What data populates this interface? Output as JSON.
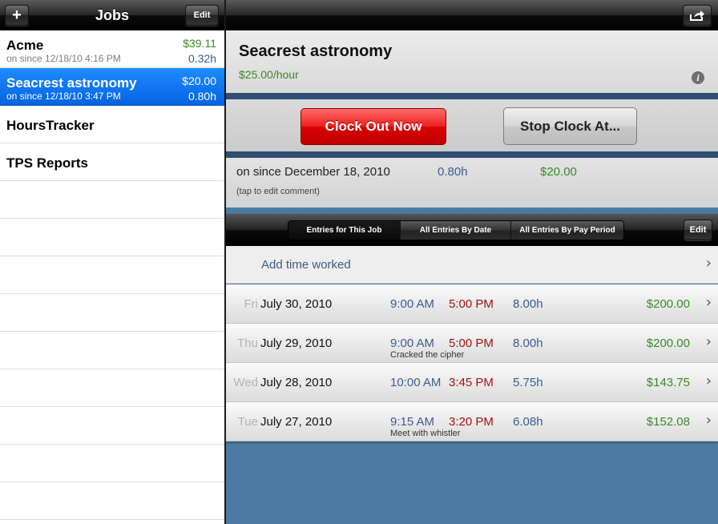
{
  "jobs_panel": {
    "title": "Jobs",
    "add_label": "+",
    "edit_label": "Edit",
    "jobs": [
      {
        "name": "Acme",
        "status": "on since 12/18/10 4:16 PM",
        "amount": "$39.11",
        "hours": "0.32h"
      },
      {
        "name": "Seacrest astronomy",
        "status": "on since 12/18/10 3:47 PM",
        "amount": "$20.00",
        "hours": "0.80h"
      },
      {
        "name": "HoursTracker",
        "status": "",
        "amount": "",
        "hours": ""
      },
      {
        "name": "TPS Reports",
        "status": "",
        "amount": "",
        "hours": ""
      }
    ]
  },
  "detail": {
    "share_icon": "share-icon",
    "job_title": "Seacrest astronomy",
    "rate": "$25.00/hour",
    "info_icon": "i",
    "clock_out_label": "Clock Out Now",
    "stop_clock_label": "Stop Clock At...",
    "session": {
      "text": "on since December 18, 2010",
      "hours": "0.80h",
      "amount": "$20.00",
      "comment": "(tap to edit comment)"
    },
    "segments": [
      "Entries for This Job",
      "All Entries By Date",
      "All Entries By Pay Period"
    ],
    "edit_label": "Edit",
    "add_time_label": "Add time worked",
    "chevron": "›",
    "entries": [
      {
        "day": "Fri",
        "date": "July 30, 2010",
        "start": "9:00 AM",
        "end": "5:00 PM",
        "hours": "8.00h",
        "amount": "$200.00",
        "comment": ""
      },
      {
        "day": "Thu",
        "date": "July 29, 2010",
        "start": "9:00 AM",
        "end": "5:00 PM",
        "hours": "8.00h",
        "amount": "$200.00",
        "comment": "Cracked the cipher"
      },
      {
        "day": "Wed",
        "date": "July 28, 2010",
        "start": "10:00 AM",
        "end": "3:45 PM",
        "hours": "5.75h",
        "amount": "$143.75",
        "comment": ""
      },
      {
        "day": "Tue",
        "date": "July 27, 2010",
        "start": "9:15 AM",
        "end": "3:20 PM",
        "hours": "6.08h",
        "amount": "$152.08",
        "comment": "Meet with whistler"
      }
    ]
  },
  "colors": {
    "selection_blue": "#0a6cf0",
    "money_green": "#3a8a25",
    "hours_blue": "#3a5c92",
    "end_time_red": "#a81010",
    "clock_out_red": "#e01010",
    "background_blue": "#4d7aa3"
  }
}
